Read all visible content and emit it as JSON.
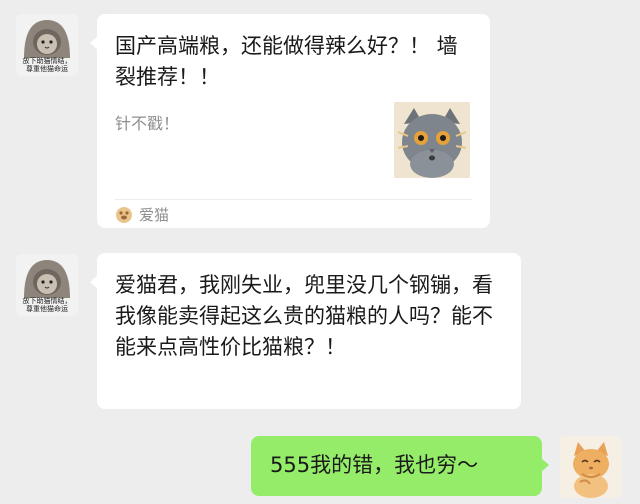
{
  "messages": [
    {
      "sender_avatar": {
        "icon": "cat-in-hood-avatar-icon",
        "caption": "放下助猫情结，\n尊重他猫命运"
      },
      "card": {
        "title": "国产高端粮，还能做得辣么好？！ 墙裂推荐！！",
        "desc": "针不戳！",
        "thumbnail": "gray-cat-surprised-icon",
        "source": {
          "icon": "cat-paw-logo-icon",
          "label": "爱猫"
        }
      }
    },
    {
      "sender_avatar": {
        "icon": "cat-in-hood-avatar-icon",
        "caption": "放下助猫情结，\n尊重他猫命运"
      },
      "text": "爱猫君，我刚失业，兜里没几个钢镚，看我像能卖得起这么贵的猫粮的人吗？能不能来点高性价比猫粮？！"
    },
    {
      "self_avatar": {
        "icon": "orange-cat-avatar-icon"
      },
      "text": "555我的错，我也穷～"
    }
  ],
  "colors": {
    "background": "#ededed",
    "incoming_bubble": "#ffffff",
    "outgoing_bubble": "#95ec69"
  }
}
